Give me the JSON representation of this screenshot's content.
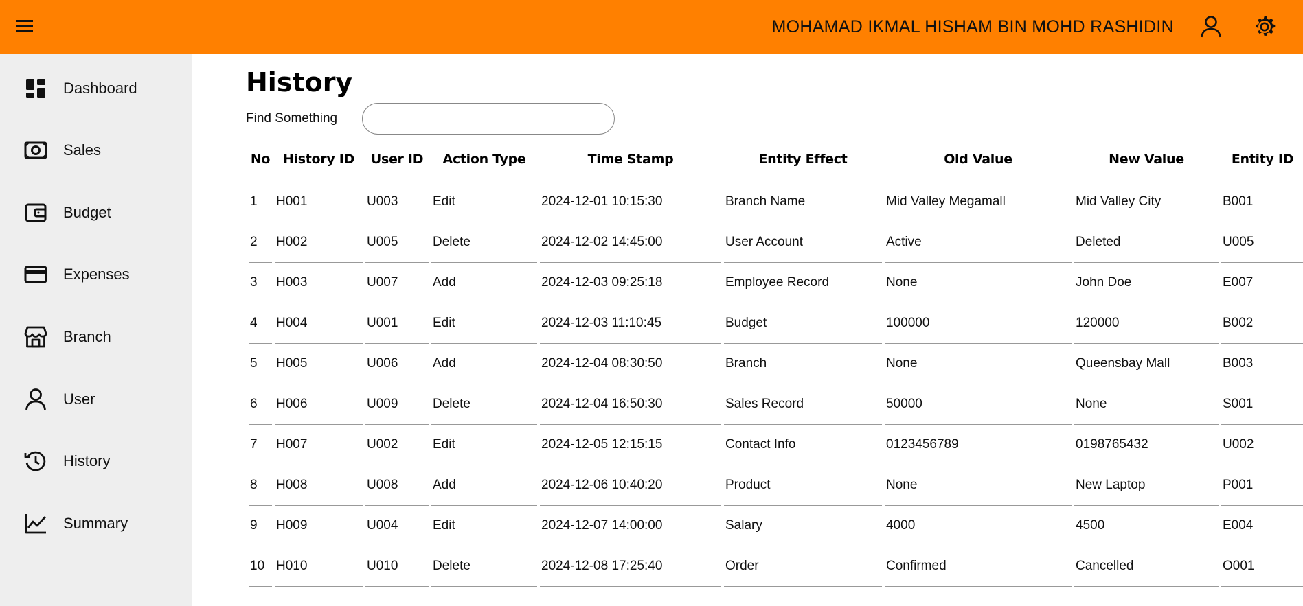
{
  "header": {
    "user_name": "MOHAMAD IKMAL HISHAM BIN MOHD RASHIDIN",
    "menu_icon": "hamburger-icon",
    "profile_icon": "user-icon",
    "settings_icon": "gear-icon",
    "bar_color": "#ff8000"
  },
  "sidebar": {
    "background": "#eeeeee",
    "items": [
      {
        "label": "Dashboard",
        "icon": "dashboard-icon"
      },
      {
        "label": "Sales",
        "icon": "cash-icon"
      },
      {
        "label": "Budget",
        "icon": "wallet-icon"
      },
      {
        "label": "Expenses",
        "icon": "credit-card-icon"
      },
      {
        "label": "Branch",
        "icon": "store-icon"
      },
      {
        "label": "User",
        "icon": "user-icon"
      },
      {
        "label": "History",
        "icon": "history-icon"
      },
      {
        "label": "Summary",
        "icon": "line-chart-icon"
      }
    ]
  },
  "main": {
    "title": "History",
    "search": {
      "label": "Find Something",
      "value": "",
      "placeholder": ""
    },
    "table": {
      "columns": [
        "No",
        "History ID",
        "User ID",
        "Action Type",
        "Time Stamp",
        "Entity Effect",
        "Old Value",
        "New Value",
        "Entity ID"
      ],
      "rows": [
        [
          "1",
          "H001",
          "U003",
          "Edit",
          "2024-12-01 10:15:30",
          "Branch Name",
          "Mid Valley Megamall",
          "Mid Valley City",
          "B001"
        ],
        [
          "2",
          "H002",
          "U005",
          "Delete",
          "2024-12-02 14:45:00",
          "User Account",
          "Active",
          "Deleted",
          "U005"
        ],
        [
          "3",
          "H003",
          "U007",
          "Add",
          "2024-12-03 09:25:18",
          "Employee Record",
          "None",
          "John Doe",
          "E007"
        ],
        [
          "4",
          "H004",
          "U001",
          "Edit",
          "2024-12-03 11:10:45",
          "Budget",
          "100000",
          "120000",
          "B002"
        ],
        [
          "5",
          "H005",
          "U006",
          "Add",
          "2024-12-04 08:30:50",
          "Branch",
          "None",
          "Queensbay Mall",
          "B003"
        ],
        [
          "6",
          "H006",
          "U009",
          "Delete",
          "2024-12-04 16:50:30",
          "Sales Record",
          "50000",
          "None",
          "S001"
        ],
        [
          "7",
          "H007",
          "U002",
          "Edit",
          "2024-12-05 12:15:15",
          "Contact Info",
          "0123456789",
          "0198765432",
          "U002"
        ],
        [
          "8",
          "H008",
          "U008",
          "Add",
          "2024-12-06 10:40:20",
          "Product",
          "None",
          "New Laptop",
          "P001"
        ],
        [
          "9",
          "H009",
          "U004",
          "Edit",
          "2024-12-07 14:00:00",
          "Salary",
          "4000",
          "4500",
          "E004"
        ],
        [
          "10",
          "H010",
          "U010",
          "Delete",
          "2024-12-08 17:25:40",
          "Order",
          "Confirmed",
          "Cancelled",
          "O001"
        ]
      ]
    }
  }
}
